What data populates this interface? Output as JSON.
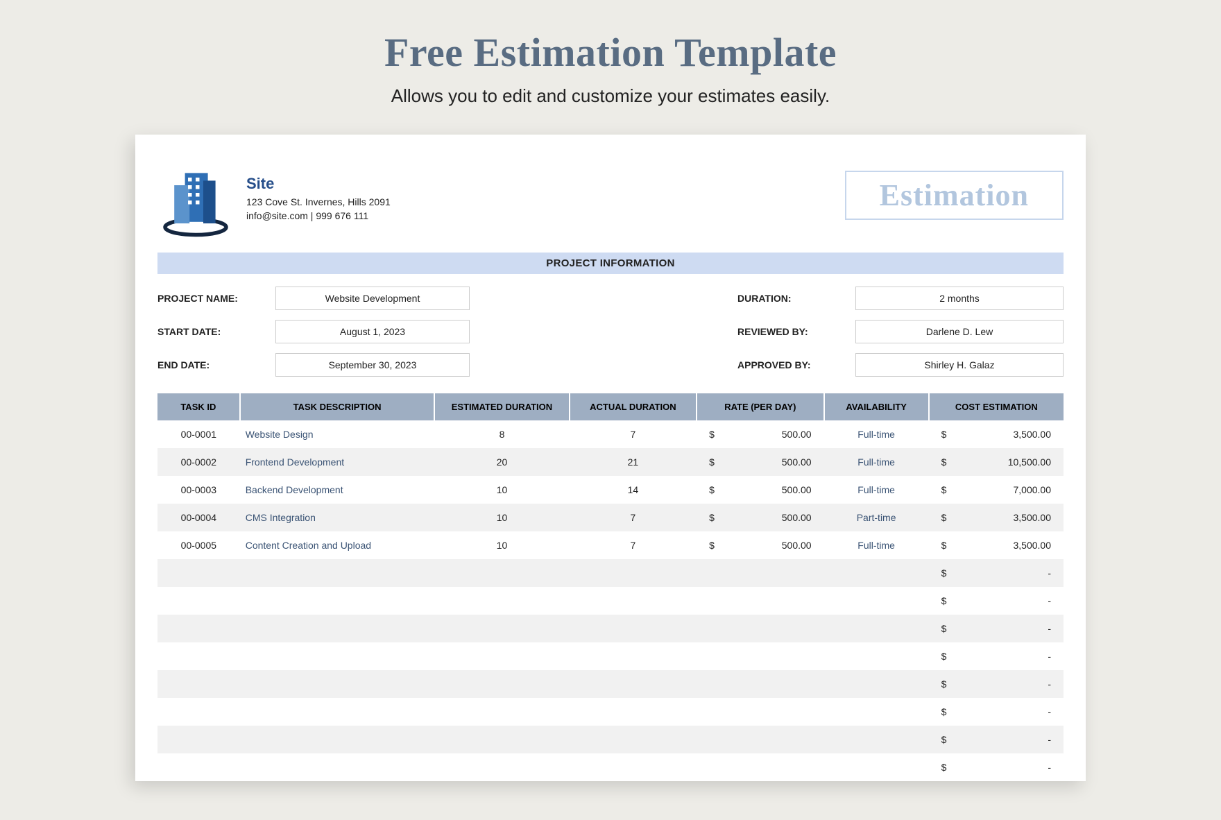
{
  "page": {
    "title": "Free Estimation Template",
    "subtitle": "Allows you to edit and customize your estimates easily."
  },
  "company": {
    "name": "Site",
    "address": "123 Cove St. Invernes, Hills 2091",
    "contact": "info@site.com | 999 676 111"
  },
  "badge": "Estimation",
  "section_banner": "PROJECT INFORMATION",
  "labels": {
    "project_name": "PROJECT NAME:",
    "start_date": "START DATE:",
    "end_date": "END DATE:",
    "duration": "DURATION:",
    "reviewed_by": "REVIEWED BY:",
    "approved_by": "APPROVED BY:"
  },
  "project": {
    "name": "Website Development",
    "start_date": "August 1, 2023",
    "end_date": "September 30, 2023",
    "duration": "2 months",
    "reviewed_by": "Darlene D. Lew",
    "approved_by": "Shirley H. Galaz"
  },
  "columns": {
    "task_id": "TASK ID",
    "task_description": "TASK DESCRIPTION",
    "estimated_duration": "ESTIMATED DURATION",
    "actual_duration": "ACTUAL DURATION",
    "rate": "RATE (PER DAY)",
    "availability": "AVAILABILITY",
    "cost_estimation": "COST ESTIMATION"
  },
  "currency": "$",
  "dash": "-",
  "tasks": [
    {
      "id": "00-0001",
      "desc": "Website Design",
      "est": "8",
      "act": "7",
      "rate": "500.00",
      "avail": "Full-time",
      "cost": "3,500.00"
    },
    {
      "id": "00-0002",
      "desc": "Frontend Development",
      "est": "20",
      "act": "21",
      "rate": "500.00",
      "avail": "Full-time",
      "cost": "10,500.00"
    },
    {
      "id": "00-0003",
      "desc": "Backend Development",
      "est": "10",
      "act": "14",
      "rate": "500.00",
      "avail": "Full-time",
      "cost": "7,000.00"
    },
    {
      "id": "00-0004",
      "desc": "CMS Integration",
      "est": "10",
      "act": "7",
      "rate": "500.00",
      "avail": "Part-time",
      "cost": "3,500.00"
    },
    {
      "id": "00-0005",
      "desc": "Content Creation and Upload",
      "est": "10",
      "act": "7",
      "rate": "500.00",
      "avail": "Full-time",
      "cost": "3,500.00"
    }
  ],
  "empty_rows": 8
}
